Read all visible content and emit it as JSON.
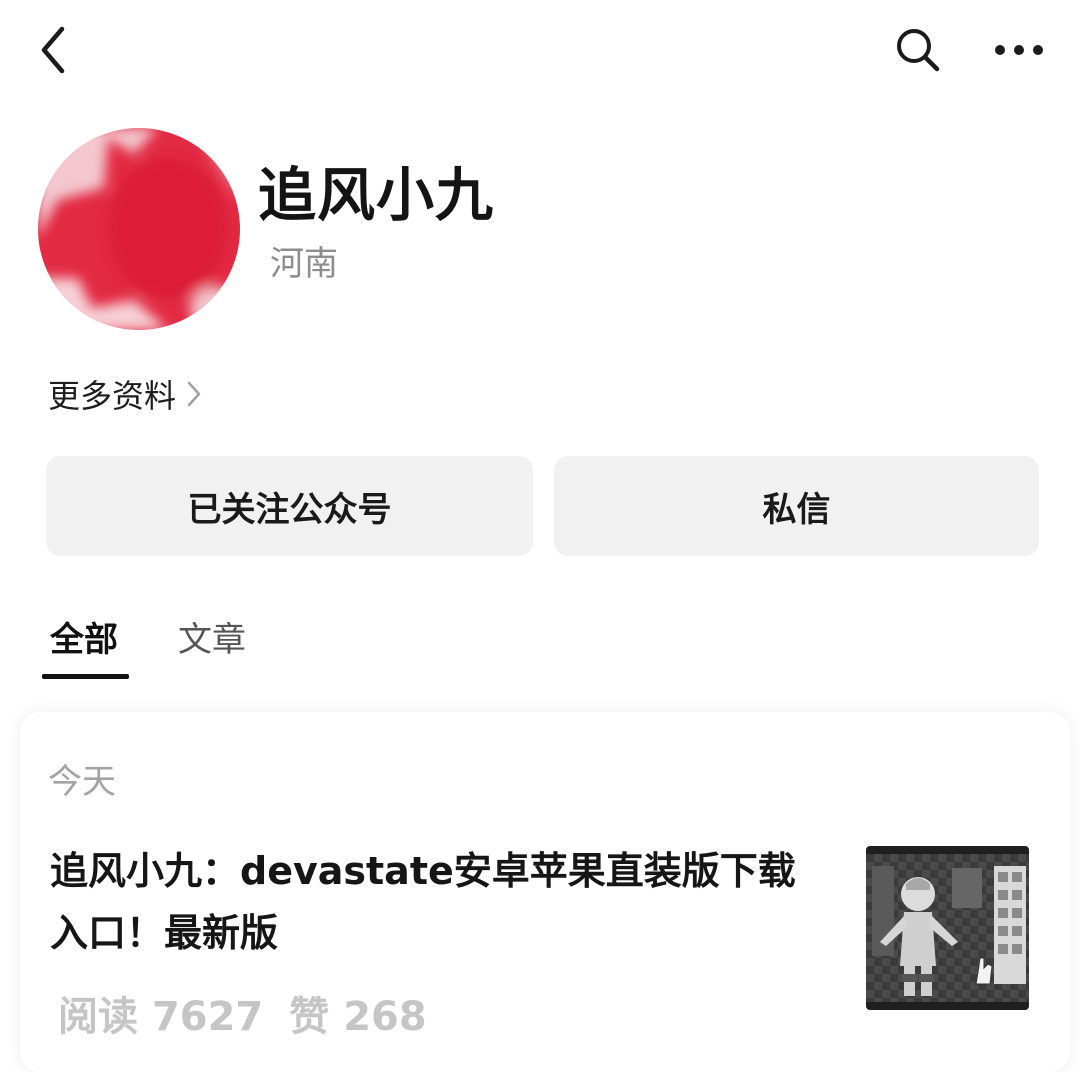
{
  "header": {
    "back_icon": "chevron-left-icon",
    "search_icon": "search-icon",
    "more_icon": "more-horizontal-icon"
  },
  "profile": {
    "name": "追风小九",
    "region": "河南",
    "avatar_colors": {
      "primary": "#e0243e",
      "highlight": "#f3c8cd"
    },
    "more_info_label": "更多资料",
    "more_info_icon": "chevron-right-icon"
  },
  "actions": {
    "follow_label": "已关注公众号",
    "message_label": "私信"
  },
  "tabs": [
    {
      "label": "全部",
      "selected": true
    },
    {
      "label": "文章",
      "selected": false
    }
  ],
  "feed": {
    "date_label": "今天",
    "articles": [
      {
        "title": "追风小九：devastate安卓苹果直装版下载入口！最新版",
        "stats_text": "阅读 7627 赞 268",
        "read_label": "阅读",
        "read_count": "7627",
        "like_label": "赞",
        "like_count": "268"
      }
    ]
  },
  "colors": {
    "background": "#ffffff",
    "button_bg": "#f1f1f1",
    "secondary_text": "#8d8d8d",
    "stats_text": "#c5c5c5"
  }
}
